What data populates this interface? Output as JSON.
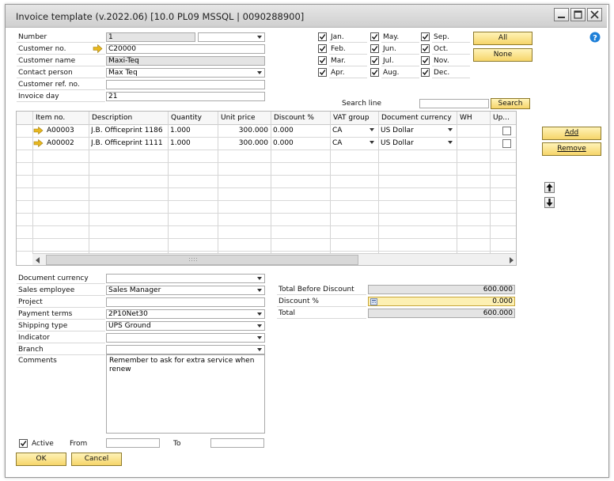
{
  "window": {
    "title": "Invoice template (v.2022.06) [10.0 PL09 MSSQL | 0090288900]"
  },
  "header": {
    "number_label": "Number",
    "number_value": "1",
    "number_series": "",
    "customer_no_label": "Customer no.",
    "customer_no_value": "C20000",
    "customer_name_label": "Customer name",
    "customer_name_value": "Maxi-Teq",
    "contact_person_label": "Contact person",
    "contact_person_value": "Max Teq",
    "customer_ref_label": "Customer ref. no.",
    "customer_ref_value": "",
    "invoice_day_label": "Invoice day",
    "invoice_day_value": "21"
  },
  "months": [
    {
      "label": "Jan.",
      "checked": true
    },
    {
      "label": "Feb.",
      "checked": true
    },
    {
      "label": "Mar.",
      "checked": true
    },
    {
      "label": "Apr.",
      "checked": true
    },
    {
      "label": "May.",
      "checked": true
    },
    {
      "label": "Jun.",
      "checked": true
    },
    {
      "label": "Jul.",
      "checked": true
    },
    {
      "label": "Aug.",
      "checked": true
    },
    {
      "label": "Sep.",
      "checked": true
    },
    {
      "label": "Oct.",
      "checked": true
    },
    {
      "label": "Nov.",
      "checked": true
    },
    {
      "label": "Dec.",
      "checked": true
    }
  ],
  "month_buttons": {
    "all": "All",
    "none": "None"
  },
  "search": {
    "label": "Search line",
    "value": "",
    "button": "Search"
  },
  "grid": {
    "columns": [
      "Item no.",
      "Description",
      "Quantity",
      "Unit price",
      "Discount %",
      "VAT group",
      "Document currency",
      "WH",
      "Up..."
    ],
    "rows": [
      {
        "item": "A00003",
        "description": "J.B. Officeprint 1186",
        "quantity": "1.000",
        "unit_price": "300.000",
        "discount": "0.000",
        "vat": "CA",
        "currency": "US Dollar",
        "wh": "",
        "up": false
      },
      {
        "item": "A00002",
        "description": "J.B. Officeprint 1111",
        "quantity": "1.000",
        "unit_price": "300.000",
        "discount": "0.000",
        "vat": "CA",
        "currency": "US Dollar",
        "wh": "",
        "up": false
      }
    ]
  },
  "side_buttons": {
    "add": "Add",
    "remove": "Remove"
  },
  "footer": {
    "doc_currency_label": "Document currency",
    "doc_currency_value": "",
    "sales_employee_label": "Sales employee",
    "sales_employee_value": "Sales Manager",
    "project_label": "Project",
    "project_value": "",
    "payment_terms_label": "Payment terms",
    "payment_terms_value": "2P10Net30",
    "shipping_type_label": "Shipping type",
    "shipping_type_value": "UPS Ground",
    "indicator_label": "Indicator",
    "indicator_value": "",
    "branch_label": "Branch",
    "branch_value": "",
    "comments_label": "Comments",
    "comments_value": "Remember to ask for extra service when renew"
  },
  "totals": {
    "before_discount_label": "Total Before Discount",
    "before_discount_value": "600.000",
    "discount_label": "Discount %",
    "discount_value": "0.000",
    "total_label": "Total",
    "total_value": "600.000"
  },
  "bottom": {
    "active_label": "Active",
    "active_checked": true,
    "from_label": "From",
    "from_value": "",
    "to_label": "To",
    "to_value": "",
    "ok": "OK",
    "cancel": "Cancel"
  },
  "colors": {
    "accent_yellow": "#f6d56a",
    "arrow_yellow": "#e8b820",
    "help_blue": "#1d7fd8"
  }
}
